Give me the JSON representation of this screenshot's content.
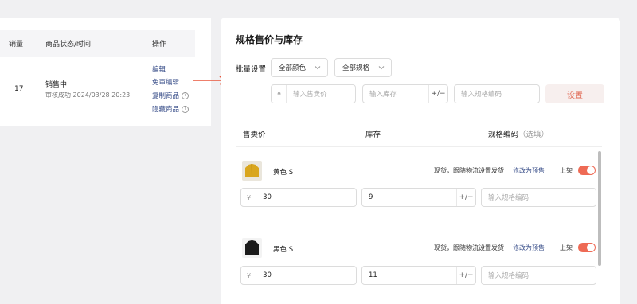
{
  "product_table": {
    "headers": {
      "sales": "销量",
      "status_time": "商品状态/时间",
      "actions": "操作"
    },
    "row": {
      "sales": "17",
      "status": "销售中",
      "time": "审核成功 2024/03/28 20:23",
      "actions": [
        "编辑",
        "免审编辑",
        "复制商品",
        "隐藏商品"
      ]
    }
  },
  "panel": {
    "title": "规格售价与库存",
    "batch_label": "批量设置",
    "color_select": "全部颜色",
    "spec_select": "全部规格",
    "price_placeholder": "输入售卖价",
    "stock_placeholder": "输入库存",
    "code_placeholder": "输入规格编码",
    "currency": "¥",
    "set_button": "设置",
    "columns": {
      "price": "售卖价",
      "stock": "库存",
      "code": "规格编码",
      "code_optional": "（选填）"
    },
    "skus": [
      {
        "name": "黄色 S",
        "ship_text": "现货，跟随物流设置发货",
        "presale_link": "修改为预售",
        "on_label": "上架",
        "price": "30",
        "stock": "9",
        "code_placeholder": "输入规格编码",
        "icon": "yellow-jacket-image"
      },
      {
        "name": "黑色 S",
        "ship_text": "现货，跟随物流设置发货",
        "presale_link": "修改为预售",
        "on_label": "上架",
        "price": "30",
        "stock": "11",
        "code_placeholder": "输入规格编码",
        "icon": "black-jacket-image"
      }
    ]
  },
  "colors": {
    "accent": "#ee6a55",
    "link": "#3a4f8a",
    "arrow": "#e8553a"
  }
}
